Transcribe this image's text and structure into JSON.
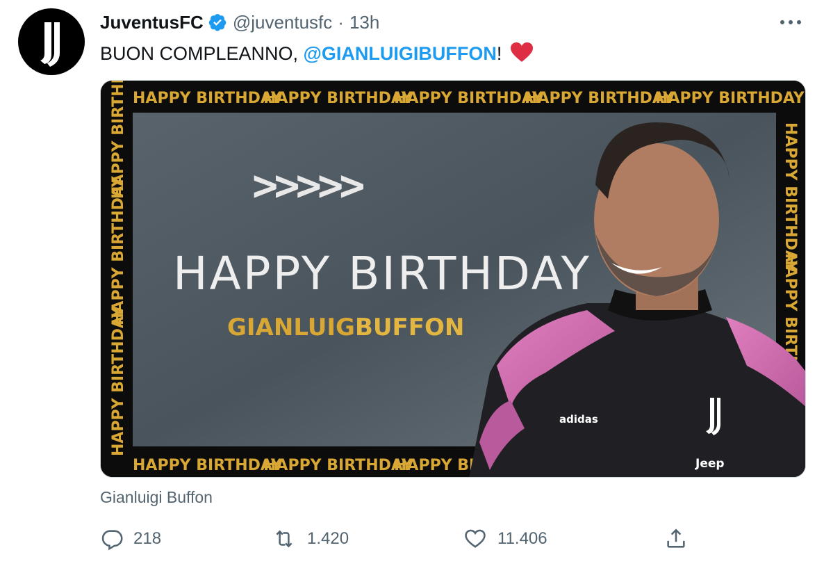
{
  "account": {
    "display_name": "JuventusFC",
    "handle": "@juventusfc",
    "separator": "·",
    "timestamp": "13h",
    "avatar_icon": "juventus-logo-icon",
    "verified_icon": "verified-badge-icon"
  },
  "tweet": {
    "text_before": "BUON COMPLEANNO, ",
    "mention": "@GIANLUIGIBUFFON",
    "text_after": "!",
    "emoji": "red-heart"
  },
  "media": {
    "headline": "HAPPY BIRTHDAY",
    "subtitle_first": "GIANLUIGI",
    "subtitle_last": "BUFFON",
    "border_text": "HAPPY BIRTHDAY",
    "chevrons": ">>>>>",
    "kit_brand_left": "adidas",
    "kit_brand_right": "Jeep"
  },
  "caption": "Gianluigi Buffon",
  "actions": {
    "replies": "218",
    "retweets": "1.420",
    "likes": "11.406"
  },
  "colors": {
    "accent": "#1d9bf0",
    "muted": "#536471",
    "gold": "#d9a733",
    "heart": "#e0245e"
  }
}
